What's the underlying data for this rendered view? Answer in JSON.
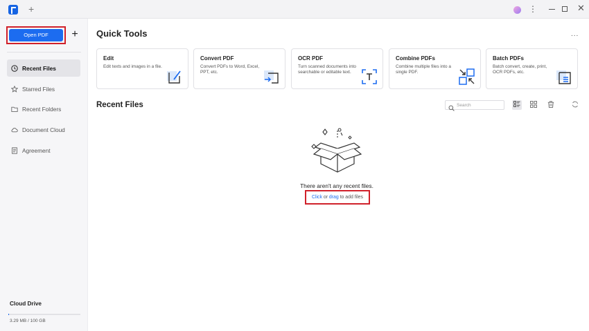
{
  "titlebar": {
    "new_tab_label": "+"
  },
  "sidebar": {
    "open_pdf_label": "Open PDF",
    "add_label": "+",
    "nav": [
      {
        "label": "Recent Files",
        "icon": "clock-icon",
        "active": true
      },
      {
        "label": "Starred Files",
        "icon": "star-icon",
        "active": false
      },
      {
        "label": "Recent Folders",
        "icon": "folder-icon",
        "active": false
      },
      {
        "label": "Document Cloud",
        "icon": "cloud-icon",
        "active": false
      },
      {
        "label": "Agreement",
        "icon": "agreement-icon",
        "active": false
      }
    ],
    "cloud_drive": {
      "label": "Cloud Drive",
      "usage_text": "3.29 MB / 100 GB",
      "used_fraction": 0.0001
    }
  },
  "quick_tools": {
    "title": "Quick Tools",
    "more_label": "...",
    "tools": [
      {
        "title": "Edit",
        "desc": "Edit texts and images in a file.",
        "icon": "edit-icon"
      },
      {
        "title": "Convert PDF",
        "desc": "Convert PDFs to Word, Excel, PPT, etc.",
        "icon": "convert-icon"
      },
      {
        "title": "OCR PDF",
        "desc": "Turn scanned documents into searchable or editable text.",
        "icon": "ocr-icon"
      },
      {
        "title": "Combine PDFs",
        "desc": "Combine multiple files into a single PDF.",
        "icon": "combine-icon"
      },
      {
        "title": "Batch PDFs",
        "desc": "Batch convert, create, print, OCR PDFs, etc.",
        "icon": "batch-icon"
      }
    ]
  },
  "recent_files": {
    "title": "Recent Files",
    "search_placeholder": "Search",
    "empty_message": "There aren't any recent files.",
    "add_files": {
      "click_label": "Click",
      "or_label": " or ",
      "drag_label": "drag",
      "suffix": " to add files"
    }
  },
  "colors": {
    "accent": "#1c6cf0",
    "highlight": "#d0202a",
    "sidebar_bg": "#f6f6f8"
  }
}
